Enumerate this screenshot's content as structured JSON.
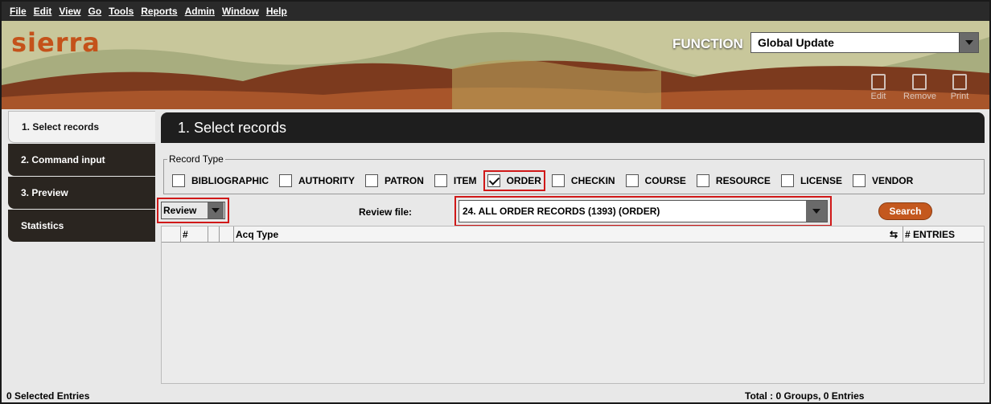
{
  "menu": [
    "File",
    "Edit",
    "View",
    "Go",
    "Tools",
    "Reports",
    "Admin",
    "Window",
    "Help"
  ],
  "banner": {
    "logo": "sierra",
    "function_label": "FUNCTION",
    "function_value": "Global Update",
    "tools": [
      "Edit",
      "Remove",
      "Print"
    ]
  },
  "nav": {
    "items": [
      "1. Select records",
      "2. Command input",
      "3. Preview",
      "Statistics"
    ]
  },
  "main": {
    "title": "1. Select records",
    "record_type_label": "Record Type",
    "record_types": [
      {
        "label": "BIBLIOGRAPHIC",
        "checked": false
      },
      {
        "label": "AUTHORITY",
        "checked": false
      },
      {
        "label": "PATRON",
        "checked": false
      },
      {
        "label": "ITEM",
        "checked": false
      },
      {
        "label": "ORDER",
        "checked": true
      },
      {
        "label": "CHECKIN",
        "checked": false
      },
      {
        "label": "COURSE",
        "checked": false
      },
      {
        "label": "RESOURCE",
        "checked": false
      },
      {
        "label": "LICENSE",
        "checked": false
      },
      {
        "label": "VENDOR",
        "checked": false
      }
    ],
    "review_mode": "Review",
    "review_file_label": "Review file:",
    "review_file_value": "24. ALL ORDER RECORDS (1393) (ORDER)",
    "search_button": "Search",
    "table_headers": [
      "#",
      "Acq Type",
      "# ENTRIES"
    ]
  },
  "status": {
    "left": "0 Selected Entries",
    "right": "Total : 0 Groups, 0 Entries"
  },
  "colors": {
    "accent": "#c4581e",
    "dark": "#1e1e1e",
    "highlight": "#d01818"
  }
}
